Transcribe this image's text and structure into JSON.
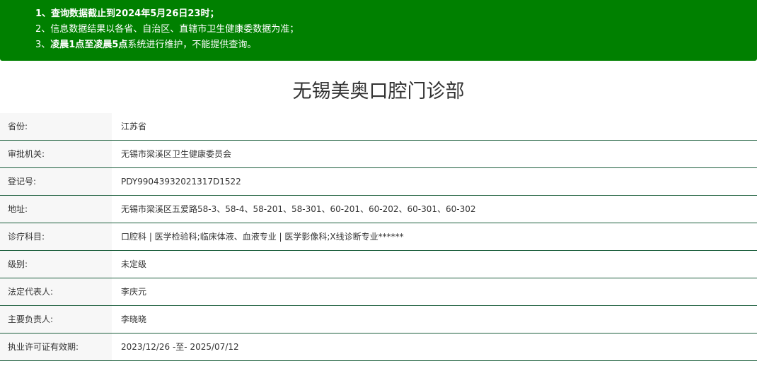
{
  "notice": {
    "line1": "1、查询数据截止到2024年5月26日23时；",
    "line2": "2、信息数据结果以各省、自治区、直辖市卫生健康委数据为准；",
    "line3_prefix": "3、",
    "line3_bold": "凌晨1点至凌晨5点",
    "line3_suffix": "系统进行维护，不能提供查询。",
    "background_color": "#008000"
  },
  "title": "无锡美奥口腔门诊部",
  "rows": [
    {
      "label": "省份:",
      "value": "江苏省"
    },
    {
      "label": "审批机关:",
      "value": "无锡市梁溪区卫生健康委员会"
    },
    {
      "label": "登记号:",
      "value": "PDY99043932021317D1522"
    },
    {
      "label": "地址:",
      "value": "无锡市梁溪区五爱路58-3、58-4、58-201、58-301、60-201、60-202、60-301、60-302"
    },
    {
      "label": "诊疗科目:",
      "value": "口腔科 | 医学检验科;临床体液、血液专业 | 医学影像科;X线诊断专业******"
    },
    {
      "label": "级别:",
      "value": "未定级"
    },
    {
      "label": "法定代表人:",
      "value": "李庆元"
    },
    {
      "label": "主要负责人:",
      "value": "李晓晓"
    },
    {
      "label": "执业许可证有效期:",
      "value": "2023/12/26 -至- 2025/07/12"
    }
  ]
}
